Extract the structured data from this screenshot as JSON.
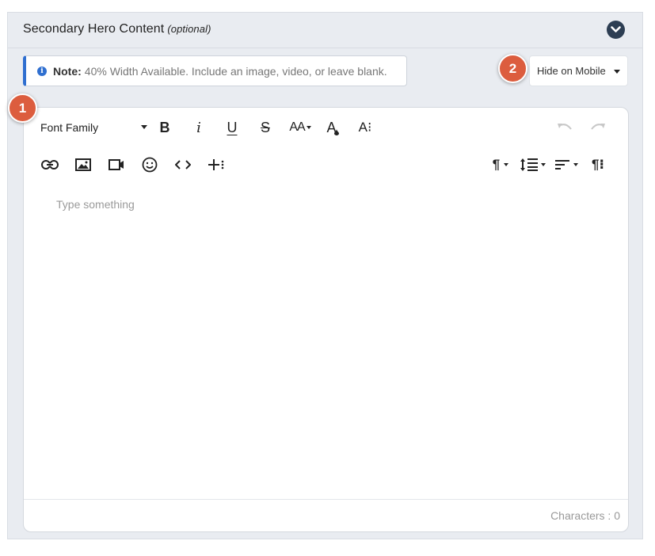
{
  "section": {
    "title": "Secondary Hero Content",
    "subtitle": "(optional)",
    "collapse_icon": "chevron-down-icon"
  },
  "note": {
    "label": "Note:",
    "text": "40% Width Available. Include an image, video, or leave blank.",
    "icon": "info-icon",
    "accent_color": "#2f6fd0"
  },
  "visibility_select": {
    "value": "Hide on Mobile"
  },
  "badges": [
    "1",
    "2"
  ],
  "badge_color": "#dc5d3e",
  "toolbar": {
    "font_family_label": "Font Family",
    "row1_buttons": [
      "bold",
      "italic",
      "underline",
      "strikethrough",
      "font-size",
      "text-color",
      "more-text",
      "undo",
      "redo"
    ],
    "row2_buttons": [
      "insert-link",
      "insert-image",
      "insert-video",
      "emoticons",
      "code-view",
      "more-insert",
      "paragraph-format",
      "line-height",
      "align",
      "more-paragraph"
    ],
    "bold_glyph": "B",
    "italic_glyph": "i",
    "underline_glyph": "U",
    "strike_glyph": "S",
    "font_size_glyph": "AA",
    "text_color_glyph": "A",
    "more_text_glyph": "A⁝",
    "paragraph_glyph": "¶",
    "more_paragraph_glyph": "¶⁝"
  },
  "editor": {
    "placeholder": "Type something",
    "characters_label": "Characters : 0"
  }
}
